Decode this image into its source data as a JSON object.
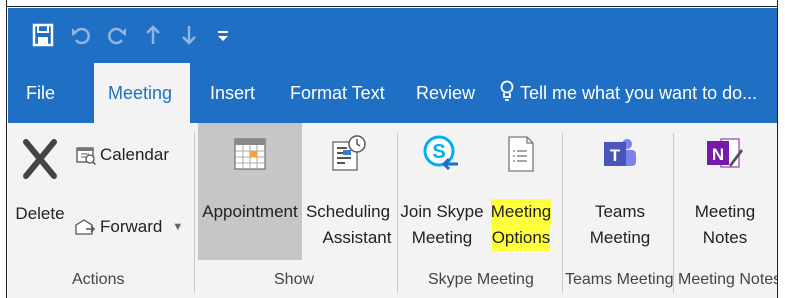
{
  "quick_access": {
    "save_icon": "save-icon",
    "undo_icon": "undo-icon",
    "redo_icon": "redo-icon",
    "up_icon": "up-arrow-icon",
    "down_icon": "down-arrow-icon",
    "more_icon": "customize-icon"
  },
  "tabs": [
    {
      "label": "File"
    },
    {
      "label": "Meeting"
    },
    {
      "label": "Insert"
    },
    {
      "label": "Format Text"
    },
    {
      "label": "Review"
    },
    {
      "label": "Tell me what you want to do..."
    }
  ],
  "ribbon": {
    "actions": {
      "delete_label": "Delete",
      "calendar_label": "Calendar",
      "forward_label": "Forward",
      "group_label": "Actions"
    },
    "show": {
      "appointment_label": "Appointment",
      "scheduling_line1": "Scheduling",
      "scheduling_line2": "Assistant",
      "group_label": "Show"
    },
    "skype": {
      "join_line1": "Join Skype",
      "join_line2": "Meeting",
      "options_line1": "Meeting",
      "options_line2": "Options",
      "group_label": "Skype Meeting"
    },
    "teams": {
      "line1": "Teams",
      "line2": "Meeting",
      "group_label": "Teams Meeting"
    },
    "notes": {
      "line1": "Meeting",
      "line2": "Notes",
      "group_label": "Meeting Notes"
    }
  },
  "colors": {
    "titlebar": "#1f6fc4",
    "highlight": "#ffff3b",
    "ribbon_bg": "#f3f3f3"
  }
}
